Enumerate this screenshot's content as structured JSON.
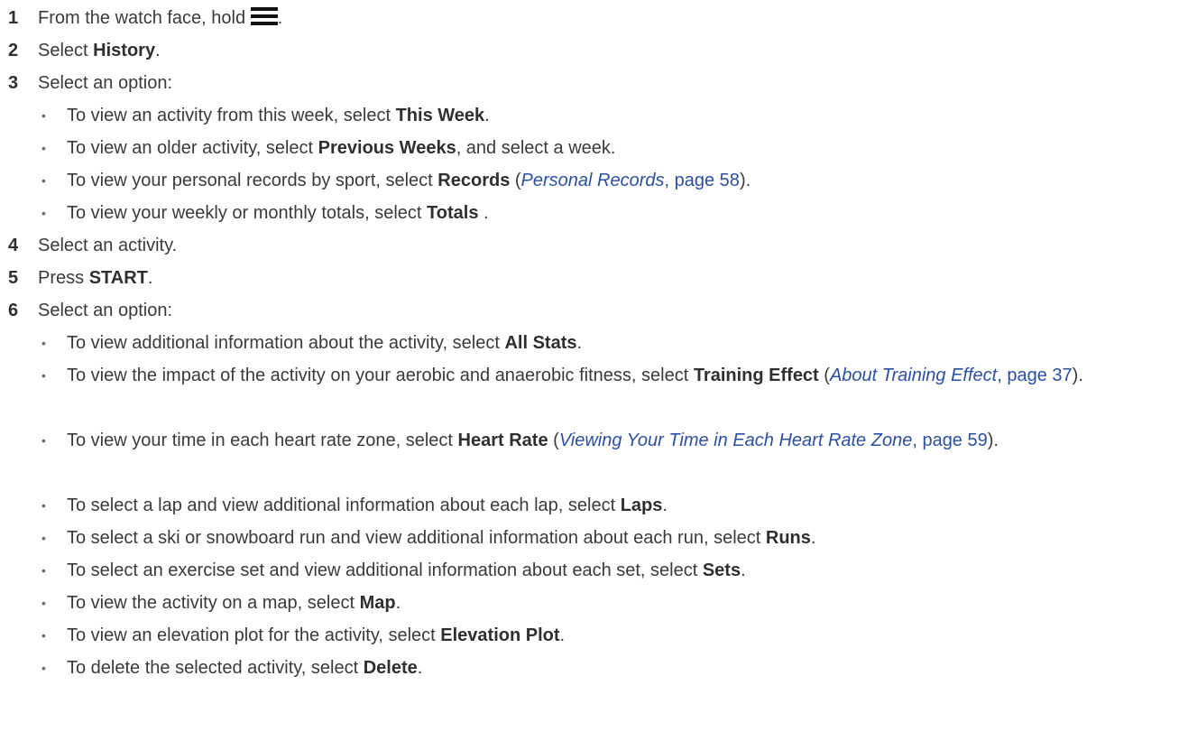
{
  "steps": [
    {
      "num": "1",
      "pre": "From the watch face, hold ",
      "post": ".",
      "icon": "menu-icon"
    },
    {
      "num": "2",
      "pre": "Select ",
      "bold": "History",
      "post": "."
    },
    {
      "num": "3",
      "pre": "Select an option:"
    },
    {
      "num": "4",
      "pre": "Select an activity."
    },
    {
      "num": "5",
      "pre": "Press ",
      "bold": "START",
      "post": "."
    },
    {
      "num": "6",
      "pre": "Select an option:"
    }
  ],
  "step3_bullets": [
    {
      "pre": "To view an activity from this week, select ",
      "bold": "This Week",
      "post": "."
    },
    {
      "pre": "To view an older activity, select ",
      "bold": "Previous Weeks",
      "post": ", and select a week."
    },
    {
      "pre": "To view your personal records by sport, select ",
      "bold": "Records",
      "mid": " (",
      "ref_title": "Personal Records",
      "ref_page": ", page 58",
      "post": ")."
    },
    {
      "pre": "To view your weekly or monthly totals, select ",
      "bold": "Totals",
      "post": " ."
    }
  ],
  "step6_bullets": [
    {
      "pre": "To view additional information about the activity, select ",
      "bold": "All Stats",
      "post": "."
    },
    {
      "pre": "To view the impact of the activity on your aerobic and anaerobic fitness, select ",
      "bold": "Training Effect",
      "mid": " (",
      "ref_title": "About Training Effect",
      "ref_page": ", page 37",
      "post": ")."
    },
    {
      "pre": "To view your time in each heart rate zone, select ",
      "bold": "Heart Rate",
      "mid": " (",
      "ref_title": "Viewing Your Time in Each Heart Rate Zone",
      "ref_page": ", page 59",
      "post": ")."
    },
    {
      "pre": "To select a lap and view additional information about each lap, select ",
      "bold": "Laps",
      "post": "."
    },
    {
      "pre": "To select a ski or snowboard run and view additional information about each run, select ",
      "bold": "Runs",
      "post": "."
    },
    {
      "pre": "To select an exercise set and view additional information about each set, select ",
      "bold": "Sets",
      "post": "."
    },
    {
      "pre": "To view the activity on a map, select ",
      "bold": "Map",
      "post": "."
    },
    {
      "pre": "To view an elevation plot for the activity, select ",
      "bold": "Elevation Plot",
      "post": "."
    },
    {
      "pre": "To delete the selected activity, select ",
      "bold": "Delete",
      "post": "."
    }
  ]
}
